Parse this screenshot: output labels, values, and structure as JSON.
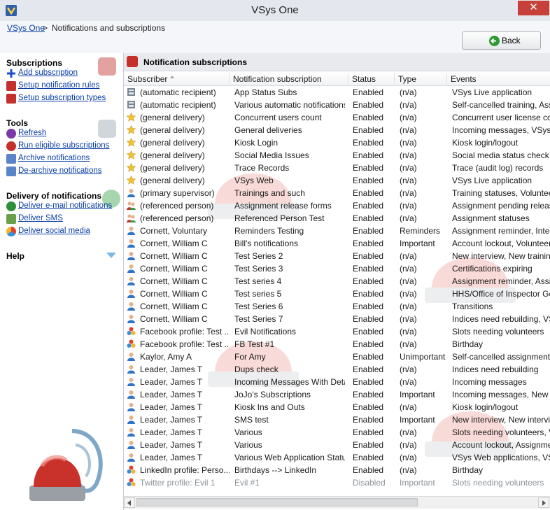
{
  "window": {
    "title": "VSys One",
    "close_glyph": "✕"
  },
  "breadcrumb": {
    "home": "VSys One",
    "separator": ">",
    "current": "Notifications and subscriptions"
  },
  "back_button": {
    "label": "Back"
  },
  "sidebar": {
    "subscriptions": {
      "title": "Subscriptions",
      "items": [
        {
          "label": "Add subscription",
          "icon": "plus-icon"
        },
        {
          "label": "Setup notification rules",
          "icon": "siren-icon"
        },
        {
          "label": "Setup subscription types",
          "icon": "siren-icon"
        }
      ]
    },
    "tools": {
      "title": "Tools",
      "items": [
        {
          "label": "Refresh",
          "icon": "refresh-icon"
        },
        {
          "label": "Run eligible subscriptions",
          "icon": "run-icon"
        },
        {
          "label": "Archive notifications",
          "icon": "archive-icon"
        },
        {
          "label": "De-archive notifications",
          "icon": "dearchive-icon"
        }
      ]
    },
    "delivery": {
      "title": "Delivery of notifications",
      "items": [
        {
          "label": "Deliver e-mail notifications",
          "icon": "email-icon"
        },
        {
          "label": "Deliver SMS",
          "icon": "sms-icon"
        },
        {
          "label": "Deliver social media",
          "icon": "social-icon"
        }
      ]
    },
    "help": {
      "title": "Help"
    }
  },
  "panel": {
    "title": "Notification subscriptions"
  },
  "columns": [
    "Subscriber",
    "Notification subscription",
    "Status",
    "Type",
    "Events"
  ],
  "colors": {
    "accent_red": "#c4302b",
    "link_blue": "#0b3fa8",
    "disabled_gray": "#8e9399"
  },
  "rows": [
    {
      "icon": "app",
      "subscriber": "(automatic recipient)",
      "subscription": "App Status Subs",
      "status": "Enabled",
      "type": "(n/a)",
      "events": "VSys Live application"
    },
    {
      "icon": "app",
      "subscriber": "(automatic recipient)",
      "subscription": "Various automatic notifications",
      "status": "Enabled",
      "type": "(n/a)",
      "events": "Self-cancelled training, Assig"
    },
    {
      "icon": "star",
      "subscriber": "(general delivery)",
      "subscription": "Concurrent users count",
      "status": "Enabled",
      "type": "(n/a)",
      "events": "Concurrent user license coun"
    },
    {
      "icon": "star",
      "subscriber": "(general delivery)",
      "subscription": "General deliveries",
      "status": "Enabled",
      "type": "(n/a)",
      "events": "Incoming messages, VSys We"
    },
    {
      "icon": "star",
      "subscriber": "(general delivery)",
      "subscription": "Kiosk Login",
      "status": "Enabled",
      "type": "(n/a)",
      "events": "Kiosk login/logout"
    },
    {
      "icon": "star",
      "subscriber": "(general delivery)",
      "subscription": "Social Media Issues",
      "status": "Enabled",
      "type": "(n/a)",
      "events": "Social media status check"
    },
    {
      "icon": "star",
      "subscriber": "(general delivery)",
      "subscription": "Trace Records",
      "status": "Enabled",
      "type": "(n/a)",
      "events": "Trace (audit log) records"
    },
    {
      "icon": "star",
      "subscriber": "(general delivery)",
      "subscription": "VSys Web",
      "status": "Enabled",
      "type": "(n/a)",
      "events": "VSys Live application"
    },
    {
      "icon": "person",
      "subscriber": "(primary supervisor)",
      "subscription": "Trainings and such",
      "status": "Enabled",
      "type": "(n/a)",
      "events": "Training statuses, Volunteer"
    },
    {
      "icon": "group",
      "subscriber": "(referenced person)",
      "subscription": "Assignment release forms",
      "status": "Enabled",
      "type": "(n/a)",
      "events": "Assignment pending release"
    },
    {
      "icon": "group",
      "subscriber": "(referenced person)",
      "subscription": "Referenced Person Test",
      "status": "Enabled",
      "type": "(n/a)",
      "events": "Assignment statuses"
    },
    {
      "icon": "person",
      "subscriber": "Cornett, Voluntary",
      "subscription": "Reminders Testing",
      "status": "Enabled",
      "type": "Reminders",
      "events": "Assignment reminder, Interv"
    },
    {
      "icon": "person",
      "subscriber": "Cornett, William C",
      "subscription": "Bill's notifications",
      "status": "Enabled",
      "type": "Important",
      "events": "Account lockout, Volunteer c"
    },
    {
      "icon": "person",
      "subscriber": "Cornett, William C",
      "subscription": "Test Series 2",
      "status": "Enabled",
      "type": "(n/a)",
      "events": "New interview, New training"
    },
    {
      "icon": "person",
      "subscriber": "Cornett, William C",
      "subscription": "Test Series 3",
      "status": "Enabled",
      "type": "(n/a)",
      "events": "Certifications expiring"
    },
    {
      "icon": "person",
      "subscriber": "Cornett, William C",
      "subscription": "Test series 4",
      "status": "Enabled",
      "type": "(n/a)",
      "events": "Assignment reminder, Assign"
    },
    {
      "icon": "person",
      "subscriber": "Cornett, William C",
      "subscription": "Test series 5",
      "status": "Enabled",
      "type": "(n/a)",
      "events": "HHS/Office of Inspector Gen"
    },
    {
      "icon": "person",
      "subscriber": "Cornett, William C",
      "subscription": "Test Series 6",
      "status": "Enabled",
      "type": "(n/a)",
      "events": "Transitions"
    },
    {
      "icon": "person",
      "subscriber": "Cornett, William C",
      "subscription": "Test Series 7",
      "status": "Enabled",
      "type": "(n/a)",
      "events": "Indices need rebuilding, VSys"
    },
    {
      "icon": "social",
      "subscriber": "Facebook profile: Test ...",
      "subscription": "Evil Notifications",
      "status": "Enabled",
      "type": "(n/a)",
      "events": "Slots needing volunteers"
    },
    {
      "icon": "social",
      "subscriber": "Facebook profile: Test ...",
      "subscription": "FB Test #1",
      "status": "Enabled",
      "type": "(n/a)",
      "events": "Birthday"
    },
    {
      "icon": "person",
      "subscriber": "Kaylor, Amy A",
      "subscription": "For Amy",
      "status": "Enabled",
      "type": "Unimportant",
      "events": "Self-cancelled assignment, Se"
    },
    {
      "icon": "person",
      "subscriber": "Leader, James T",
      "subscription": "Dups check",
      "status": "Enabled",
      "type": "(n/a)",
      "events": "Indices need rebuilding"
    },
    {
      "icon": "person",
      "subscriber": "Leader, James T",
      "subscription": "Incoming Messages With Details",
      "status": "Enabled",
      "type": "(n/a)",
      "events": "Incoming messages"
    },
    {
      "icon": "person",
      "subscriber": "Leader, James T",
      "subscription": "JoJo's Subscriptions",
      "status": "Enabled",
      "type": "Important",
      "events": "Incoming messages, New tra"
    },
    {
      "icon": "person",
      "subscriber": "Leader, James T",
      "subscription": "Kiosk Ins and Outs",
      "status": "Enabled",
      "type": "(n/a)",
      "events": "Kiosk login/logout"
    },
    {
      "icon": "person",
      "subscriber": "Leader, James T",
      "subscription": "SMS test",
      "status": "Enabled",
      "type": "Important",
      "events": "New interview, New intervie"
    },
    {
      "icon": "person",
      "subscriber": "Leader, James T",
      "subscription": "Various",
      "status": "Enabled",
      "type": "(n/a)",
      "events": "Slots needing volunteers, Vo"
    },
    {
      "icon": "person",
      "subscriber": "Leader, James T",
      "subscription": "Various",
      "status": "Enabled",
      "type": "(n/a)",
      "events": "Account lockout, Assignmen"
    },
    {
      "icon": "person",
      "subscriber": "Leader, James T",
      "subscription": "Various Web Application Statu...",
      "status": "Enabled",
      "type": "(n/a)",
      "events": "VSys Web applications, VSys"
    },
    {
      "icon": "social",
      "subscriber": "LinkedIn profile: Perso...",
      "subscription": "Birthdays --> LinkedIn",
      "status": "Enabled",
      "type": "(n/a)",
      "events": "Birthday"
    },
    {
      "icon": "social",
      "subscriber": "Twitter profile: Evil 1",
      "subscription": "Evil #1",
      "status": "Disabled",
      "type": "Important",
      "events": "Slots needing volunteers",
      "disabled": true
    }
  ]
}
